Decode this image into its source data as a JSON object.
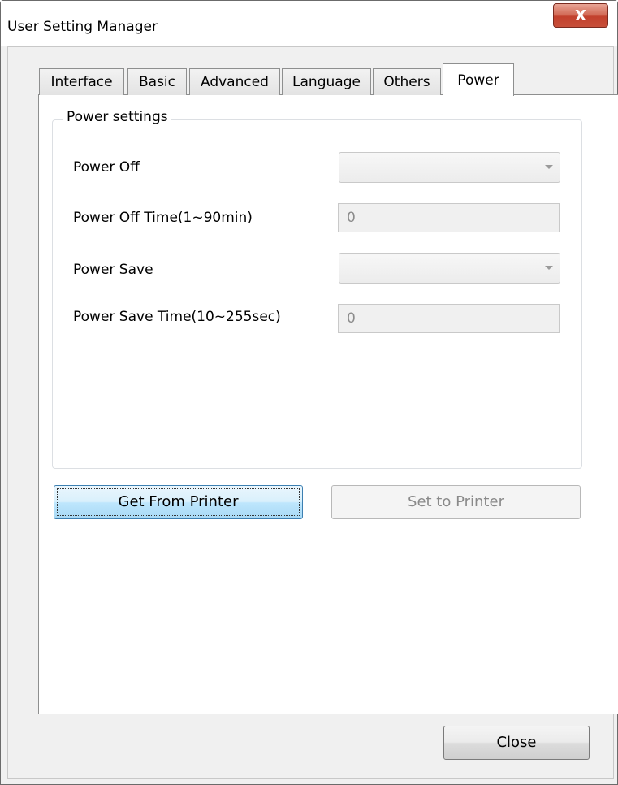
{
  "window": {
    "title": "User Setting Manager",
    "close_glyph": "X"
  },
  "tabs": [
    {
      "label": "Interface"
    },
    {
      "label": "Basic"
    },
    {
      "label": "Advanced"
    },
    {
      "label": "Language"
    },
    {
      "label": "Others"
    },
    {
      "label": "Power"
    }
  ],
  "active_tab": "Power",
  "power_settings": {
    "group_title": "Power settings",
    "power_off_label": "Power Off",
    "power_off_value": "",
    "power_off_time_label": "Power Off Time(1~90min)",
    "power_off_time_value": "0",
    "power_save_label": "Power Save",
    "power_save_value": "",
    "power_save_time_label": "Power Save Time(10~255sec)",
    "power_save_time_value": "0"
  },
  "buttons": {
    "get_from_printer": "Get From Printer",
    "set_to_printer": "Set to Printer",
    "close": "Close"
  },
  "colors": {
    "close_button": "#c7402c",
    "focus_button": "#bee6fd"
  }
}
